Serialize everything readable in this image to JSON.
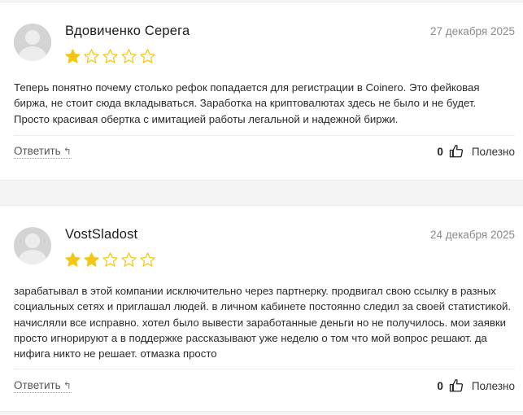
{
  "colors": {
    "star_filled": "#f2c614",
    "star_outline": "#f2c614",
    "divider": "#ececec"
  },
  "reviews": [
    {
      "author": "Вдовиченко Серега",
      "date": "27 декабря 2025",
      "rating": 1,
      "max_rating": 5,
      "text": "Теперь понятно почему столько рефок попадается для регистрации в Coinero. Это фейковая биржа, не стоит сюда вкладываться. Заработка на криптовалютах здесь не было и не будет. Просто красивая обертка с имитацией работы легальной и надежной биржи.",
      "reply_label": "Ответить",
      "votes": "0",
      "useful_label": "Полезно"
    },
    {
      "author": "VostSladost",
      "date": "24 декабря 2025",
      "rating": 2,
      "max_rating": 5,
      "text": "зарабатывал в этой компании исключительно через партнерку. продвигал свою ссылку в разных социальных сетях и приглашал людей. в личном кабинете постоянно следил за своей статистикой. начисляли все исправно. хотел было вывести заработанные деньги но не получилось. мои заявки просто игнорируют а в поддержке рассказывают уже неделю о том что мой вопрос решают. да нифига никто не решает. отмазка просто",
      "reply_label": "Ответить",
      "votes": "0",
      "useful_label": "Полезно"
    }
  ]
}
